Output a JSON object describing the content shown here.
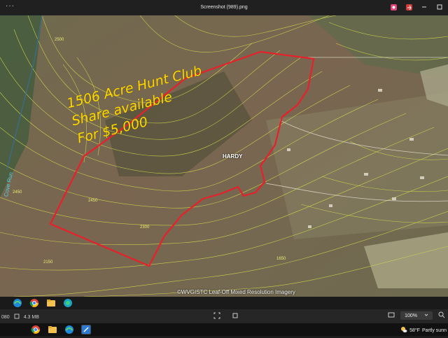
{
  "window": {
    "title": "Screenshot (989).png",
    "menu_glyph": "···",
    "controls": [
      "photos-icon",
      "share-icon",
      "minimize-icon",
      "maximize-icon"
    ]
  },
  "map": {
    "handwritten": [
      "1506 Acre Hunt Club",
      "Share available",
      "For $5,000"
    ],
    "place_label": "HARDY",
    "road_label": "Cove Run",
    "contour_labels": [
      "2500",
      "2450",
      "2450",
      "2150",
      "2300",
      "1650"
    ],
    "credit": "©WVGISTC Leaf-Off Mixed Resolution Imagery",
    "boundary_color": "#e8202a",
    "contour_color": "#d8e24a"
  },
  "taskbar_top": {
    "icons": [
      "edge-icon",
      "chrome-icon",
      "folder-icon",
      "edge-beta-icon"
    ]
  },
  "status": {
    "left_value": "080",
    "file_size": "4.3 MB",
    "zoom": "100%"
  },
  "taskbar_bottom": {
    "apps": [
      "chrome-icon",
      "file-explorer-icon",
      "edge-icon",
      "paint-icon"
    ],
    "temperature": "58°F",
    "weather": "Partly sunn"
  }
}
